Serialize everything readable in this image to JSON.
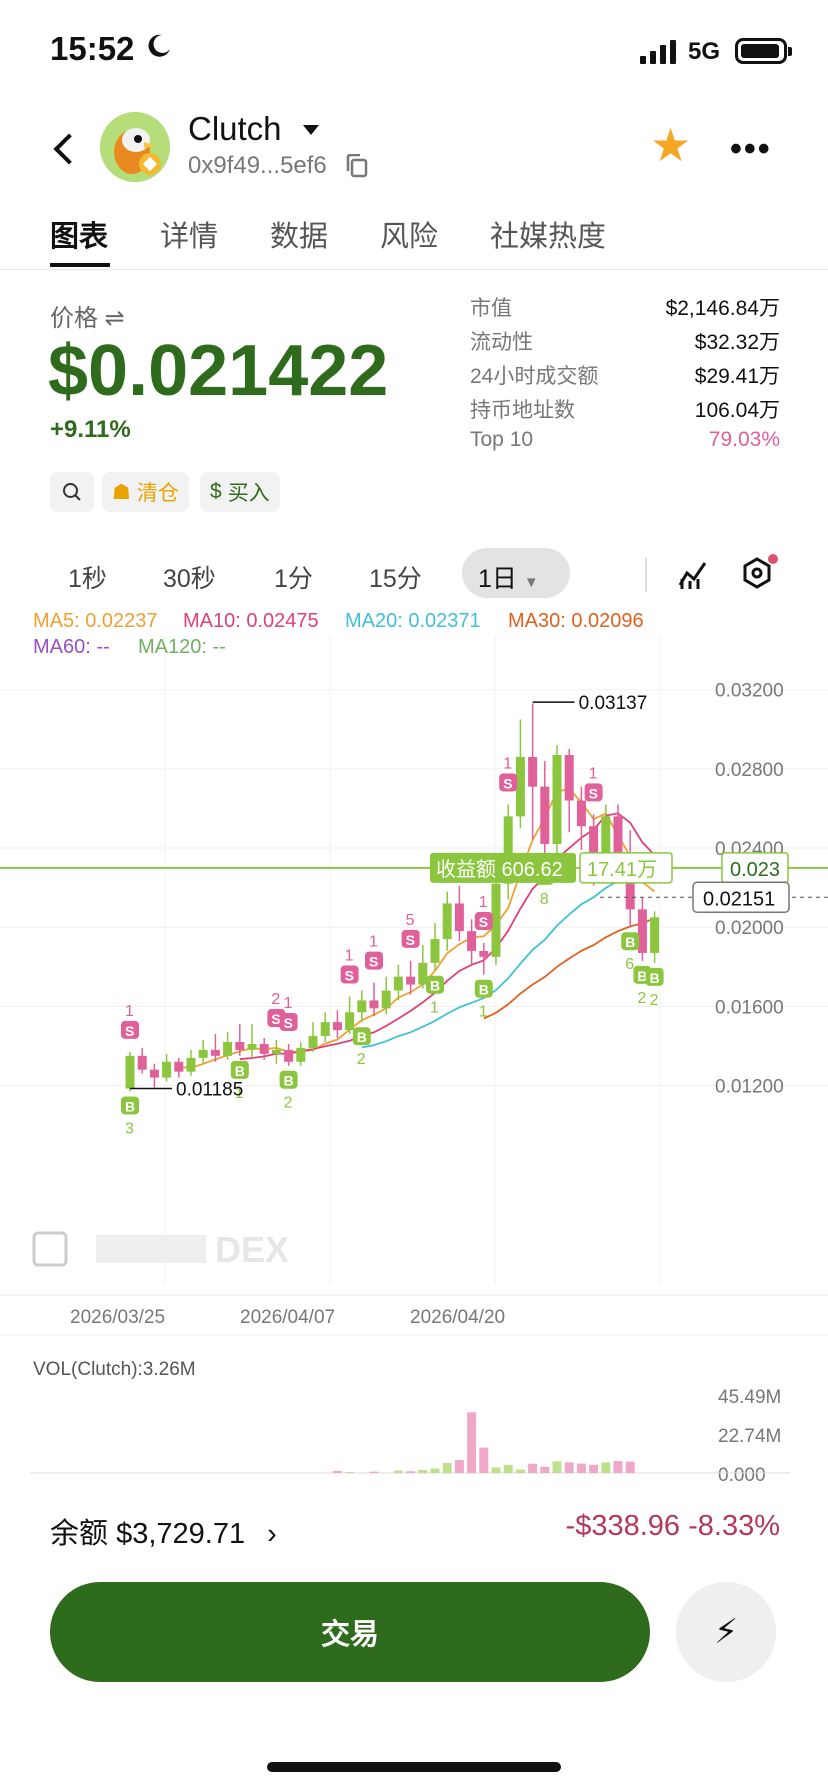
{
  "status_bar": {
    "time": "15:52",
    "network": "5G"
  },
  "token": {
    "name": "Clutch",
    "address": "0x9f49...5ef6"
  },
  "tabs": [
    "图表",
    "详情",
    "数据",
    "风险",
    "社媒热度"
  ],
  "price_section": {
    "label": "价格",
    "price": "$0.021422",
    "change": "+9.11%"
  },
  "stats": [
    {
      "key": "市值",
      "value": "$2,146.84万"
    },
    {
      "key": "流动性",
      "value": "$32.32万"
    },
    {
      "key": "24小时成交额",
      "value": "$29.41万"
    },
    {
      "key": "持币地址数",
      "value": "106.04万"
    },
    {
      "key": "Top 10",
      "value": "79.03%"
    }
  ],
  "actions": {
    "clear": "清仓",
    "buy": "买入"
  },
  "intervals": [
    "1秒",
    "30秒",
    "1分",
    "15分",
    "1日"
  ],
  "ma": {
    "ma5": "MA5: 0.02237",
    "ma10": "MA10: 0.02475",
    "ma20": "MA20: 0.02371",
    "ma30": "MA30: 0.02096",
    "ma60": "MA60: --",
    "ma120": "MA120: --"
  },
  "colors": {
    "up": "#8cc63f",
    "down": "#e0609a",
    "brand": "#2f6b1d",
    "ma5": "#f0a030",
    "ma10": "#e0407a",
    "ma20": "#40c0d8",
    "ma30": "#e06020"
  },
  "chart_data": {
    "type": "candlestick",
    "y_ticks": [
      "0.03200",
      "0.02800",
      "0.02400",
      "0.02000",
      "0.01600",
      "0.01200"
    ],
    "ylim": [
      0.0095,
      0.0335
    ],
    "x_ticks": [
      "2026/03/25",
      "2026/04/07",
      "2026/04/20"
    ],
    "high_label": "0.03137",
    "low_label": "0.01185",
    "current_price": "0.02151",
    "cost_line": "0.023",
    "profit_label": "收益额 606.62",
    "profit_value": "17.41万",
    "watermark": "DEX",
    "candles": [
      [
        0.01185,
        0.0135,
        0.0117,
        0.0137
      ],
      [
        0.0135,
        0.0128,
        0.0126,
        0.0139
      ],
      [
        0.0128,
        0.0124,
        0.0119,
        0.0131
      ],
      [
        0.0124,
        0.0132,
        0.0122,
        0.0136
      ],
      [
        0.0132,
        0.0127,
        0.0124,
        0.0134
      ],
      [
        0.0127,
        0.0134,
        0.0125,
        0.0138
      ],
      [
        0.0134,
        0.0138,
        0.0131,
        0.0143
      ],
      [
        0.0138,
        0.0135,
        0.0132,
        0.0146
      ],
      [
        0.0135,
        0.0142,
        0.0133,
        0.0147
      ],
      [
        0.0142,
        0.0138,
        0.0135,
        0.0151
      ],
      [
        0.0138,
        0.0141,
        0.0134,
        0.0151
      ],
      [
        0.0141,
        0.0136,
        0.0133,
        0.0144
      ],
      [
        0.0136,
        0.0138,
        0.0131,
        0.0143
      ],
      [
        0.0138,
        0.0132,
        0.013,
        0.0141
      ],
      [
        0.0132,
        0.0139,
        0.013,
        0.0142
      ],
      [
        0.0139,
        0.0145,
        0.0137,
        0.0152
      ],
      [
        0.0145,
        0.0152,
        0.0142,
        0.0157
      ],
      [
        0.0152,
        0.0148,
        0.0144,
        0.0158
      ],
      [
        0.0148,
        0.0157,
        0.0146,
        0.0165
      ],
      [
        0.0157,
        0.0163,
        0.0152,
        0.0168
      ],
      [
        0.0163,
        0.0159,
        0.0155,
        0.0172
      ],
      [
        0.0159,
        0.0168,
        0.0156,
        0.0175
      ],
      [
        0.0168,
        0.0175,
        0.0163,
        0.0181
      ],
      [
        0.0175,
        0.0171,
        0.0166,
        0.0183
      ],
      [
        0.0171,
        0.0182,
        0.0169,
        0.0191
      ],
      [
        0.0182,
        0.0194,
        0.0178,
        0.0202
      ],
      [
        0.0194,
        0.0212,
        0.0188,
        0.0218
      ],
      [
        0.0212,
        0.0198,
        0.0193,
        0.0221
      ],
      [
        0.0198,
        0.0188,
        0.0181,
        0.0204
      ],
      [
        0.0188,
        0.0185,
        0.0176,
        0.0192
      ],
      [
        0.0185,
        0.0222,
        0.0181,
        0.0228
      ],
      [
        0.0222,
        0.0256,
        0.0214,
        0.0262
      ],
      [
        0.0256,
        0.0286,
        0.025,
        0.0305
      ],
      [
        0.0286,
        0.0271,
        0.0244,
        0.0313
      ],
      [
        0.0271,
        0.0242,
        0.0233,
        0.0284
      ],
      [
        0.0242,
        0.0287,
        0.0235,
        0.0292
      ],
      [
        0.0287,
        0.0264,
        0.0248,
        0.029
      ],
      [
        0.0264,
        0.0251,
        0.0239,
        0.0271
      ],
      [
        0.0251,
        0.0229,
        0.0221,
        0.0257
      ],
      [
        0.0229,
        0.0256,
        0.0224,
        0.0262
      ],
      [
        0.0256,
        0.0233,
        0.0226,
        0.0262
      ],
      [
        0.0233,
        0.0209,
        0.02,
        0.0249
      ],
      [
        0.0209,
        0.0187,
        0.0183,
        0.0215
      ],
      [
        0.0187,
        0.0205,
        0.0182,
        0.0208
      ]
    ],
    "volume_label": "VOL(Clutch):3.26M",
    "volume_ticks": [
      "45.49M",
      "22.74M",
      "0.000"
    ],
    "volume_ylim": [
      0,
      45.49
    ],
    "volumes": [
      0,
      0,
      0,
      0,
      0,
      0,
      0,
      0,
      0,
      0,
      0,
      0,
      0,
      0,
      0,
      0,
      0,
      1.2,
      0.6,
      0,
      0.8,
      0,
      1.4,
      1,
      1.8,
      2.6,
      5.8,
      7.6,
      35.4,
      14.8,
      3.2,
      4.8,
      2.0,
      5.4,
      3.6,
      6.8,
      6.2,
      5.5,
      4.8,
      6.2,
      7.0,
      6.6
    ]
  },
  "balance": {
    "label": "余额",
    "value": "$3,729.71",
    "pnl": "-$338.96",
    "pnl_pct": "-8.33%"
  },
  "trade_button": "交易"
}
